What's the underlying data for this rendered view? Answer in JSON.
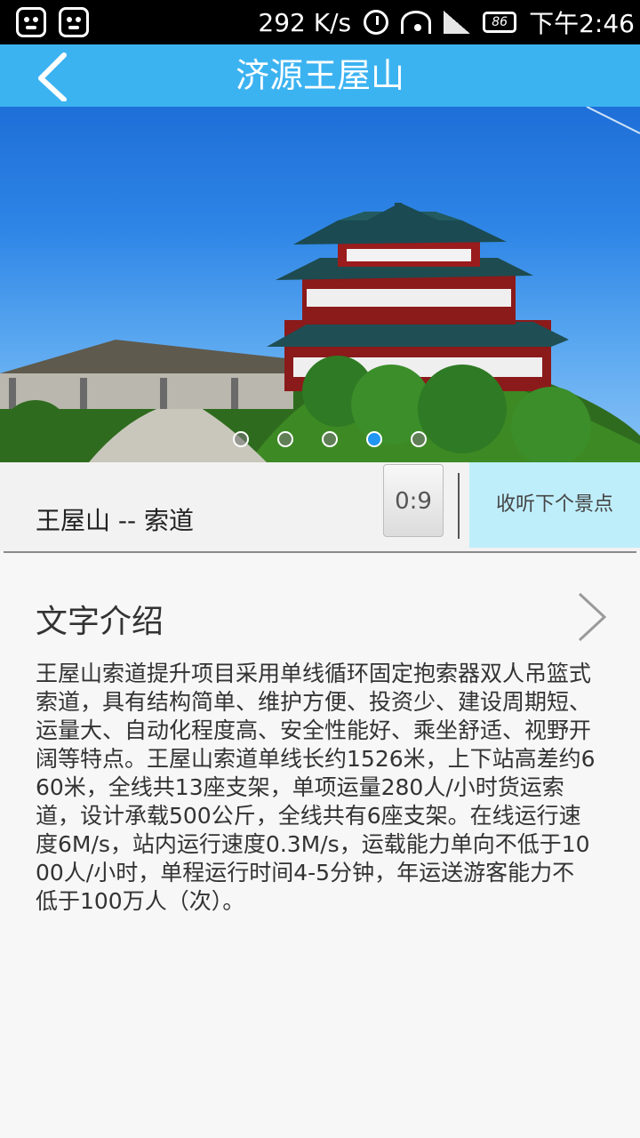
{
  "status_bar": {
    "network_speed": "292 K/s",
    "battery": "86",
    "time": "下午2:46",
    "icons": [
      "app-icon",
      "app-icon",
      "alarm-icon",
      "wifi-icon",
      "signal-icon",
      "battery-icon"
    ]
  },
  "header": {
    "title": "济源王屋山",
    "back_icon": "chevron-left-icon"
  },
  "gallery": {
    "image_count": 5,
    "active_index": 3
  },
  "audio": {
    "track_title": "王屋山 -- 索道",
    "play_label": "0:9",
    "next_label": "收听下个景点"
  },
  "intro": {
    "heading": "文字介绍",
    "body": "王屋山索道提升项目采用单线循环固定抱索器双人吊篮式索道，具有结构简单、维护方便、投资少、建设周期短、运量大、自动化程度高、安全性能好、乘坐舒适、视野开阔等特点。王屋山索道单线长约1526米，上下站高差约660米，全线共13座支架，单项运量280人/小时货运索道，设计承载500公斤，全线共有6座支架。在线运行速度6M/s，站内运行速度0.3M/s，运载能力单向不低于1000人/小时，单程运行时间4-5分钟，年运送游客能力不低于100万人（次）。"
  },
  "colors": {
    "title_bar": "#3cb3f1",
    "next_button": "#bfeefb",
    "active_dot": "#2196f3"
  }
}
